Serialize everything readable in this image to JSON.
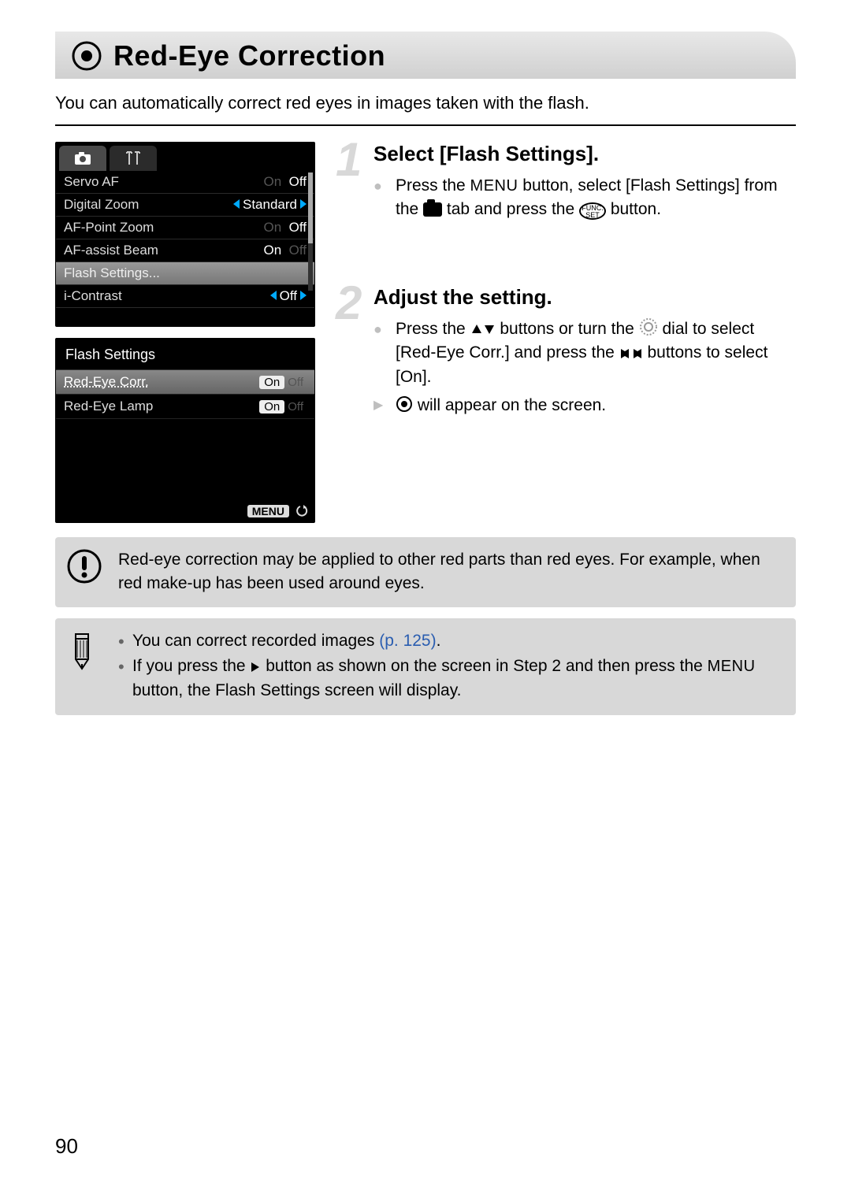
{
  "header": {
    "title": "Red-Eye Correction"
  },
  "intro": "You can automatically correct red eyes in images taken with the flash.",
  "lcd1": {
    "rows": [
      {
        "label": "Servo AF",
        "dim": "On",
        "value": "Off"
      },
      {
        "label": "Digital Zoom",
        "value": "Standard",
        "arrows": true
      },
      {
        "label": "AF-Point Zoom",
        "dim": "On",
        "value": "Off"
      },
      {
        "label": "AF-assist Beam",
        "value": "On",
        "dimAfter": "Off"
      },
      {
        "label": "Flash Settings...",
        "selected": true
      },
      {
        "label": "i-Contrast",
        "value": "Off",
        "arrows": true
      }
    ]
  },
  "lcd2": {
    "title": "Flash Settings",
    "rows": [
      {
        "label": "Red-Eye Corr.",
        "on": "On",
        "off": "Off",
        "selected": true
      },
      {
        "label": "Red-Eye Lamp",
        "on": "On",
        "off": "Off"
      }
    ],
    "menu_label": "MENU"
  },
  "step1": {
    "num": "1",
    "title": "Select [Flash Settings].",
    "line_a": "Press the ",
    "menu_word": "MENU",
    "line_b": " button, select [Flash Settings] from the ",
    "line_c": " tab and press the ",
    "line_d": " button."
  },
  "step2": {
    "num": "2",
    "title": "Adjust the setting.",
    "line_a": "Press the ",
    "line_b": " buttons or turn the ",
    "line_c": " dial to select [Red-Eye Corr.] and press the ",
    "line_d": " buttons to select [On].",
    "line_e": " will appear on the screen."
  },
  "warning": "Red-eye correction may be applied to other red parts than red eyes. For example, when red make-up has been used around eyes.",
  "tips": {
    "t1a": "You can correct recorded images ",
    "t1_link": "(p. 125)",
    "t1b": ".",
    "t2a": "If you press the ",
    "t2b": " button as shown on the screen in Step 2 and then press the ",
    "t2c": "MENU",
    "t2d": " button, the Flash Settings screen will display."
  },
  "page_number": "90"
}
